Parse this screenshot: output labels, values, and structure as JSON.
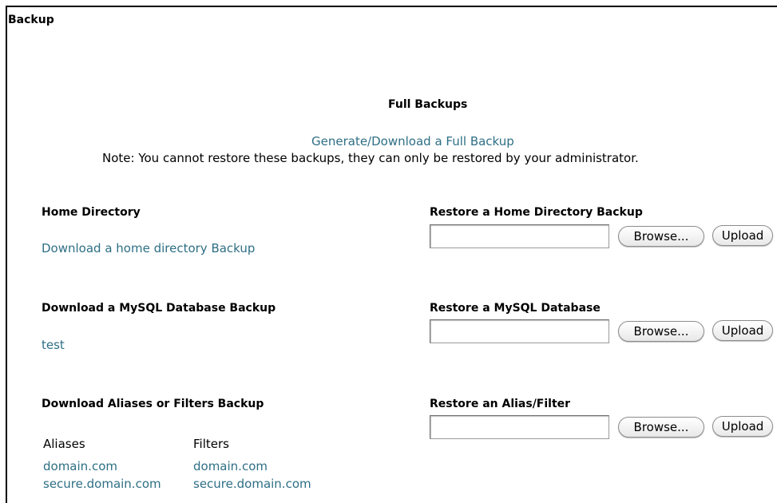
{
  "page_title": "Backup",
  "full_backups": {
    "heading": "Full Backups",
    "generate_link": "Generate/Download a Full Backup",
    "note": "Note: You cannot restore these backups, they can only be restored by your administrator."
  },
  "home_directory": {
    "heading": "Home Directory",
    "download_link": "Download a home directory Backup",
    "restore_heading": "Restore a Home Directory Backup",
    "browse_label": "Browse...",
    "upload_label": "Upload"
  },
  "mysql": {
    "heading": "Download a MySQL Database Backup",
    "databases": [
      "test"
    ],
    "restore_heading": "Restore a MySQL Database",
    "browse_label": "Browse...",
    "upload_label": "Upload"
  },
  "aliases_filters": {
    "heading": "Download Aliases or Filters Backup",
    "aliases_header": "Aliases",
    "filters_header": "Filters",
    "aliases": [
      "domain.com",
      "secure.domain.com"
    ],
    "filters": [
      "domain.com",
      "secure.domain.com"
    ],
    "restore_heading": "Restore an Alias/Filter",
    "browse_label": "Browse...",
    "upload_label": "Upload"
  },
  "colors": {
    "link": "#2e6f85",
    "text": "#000000",
    "border": "#000000"
  }
}
